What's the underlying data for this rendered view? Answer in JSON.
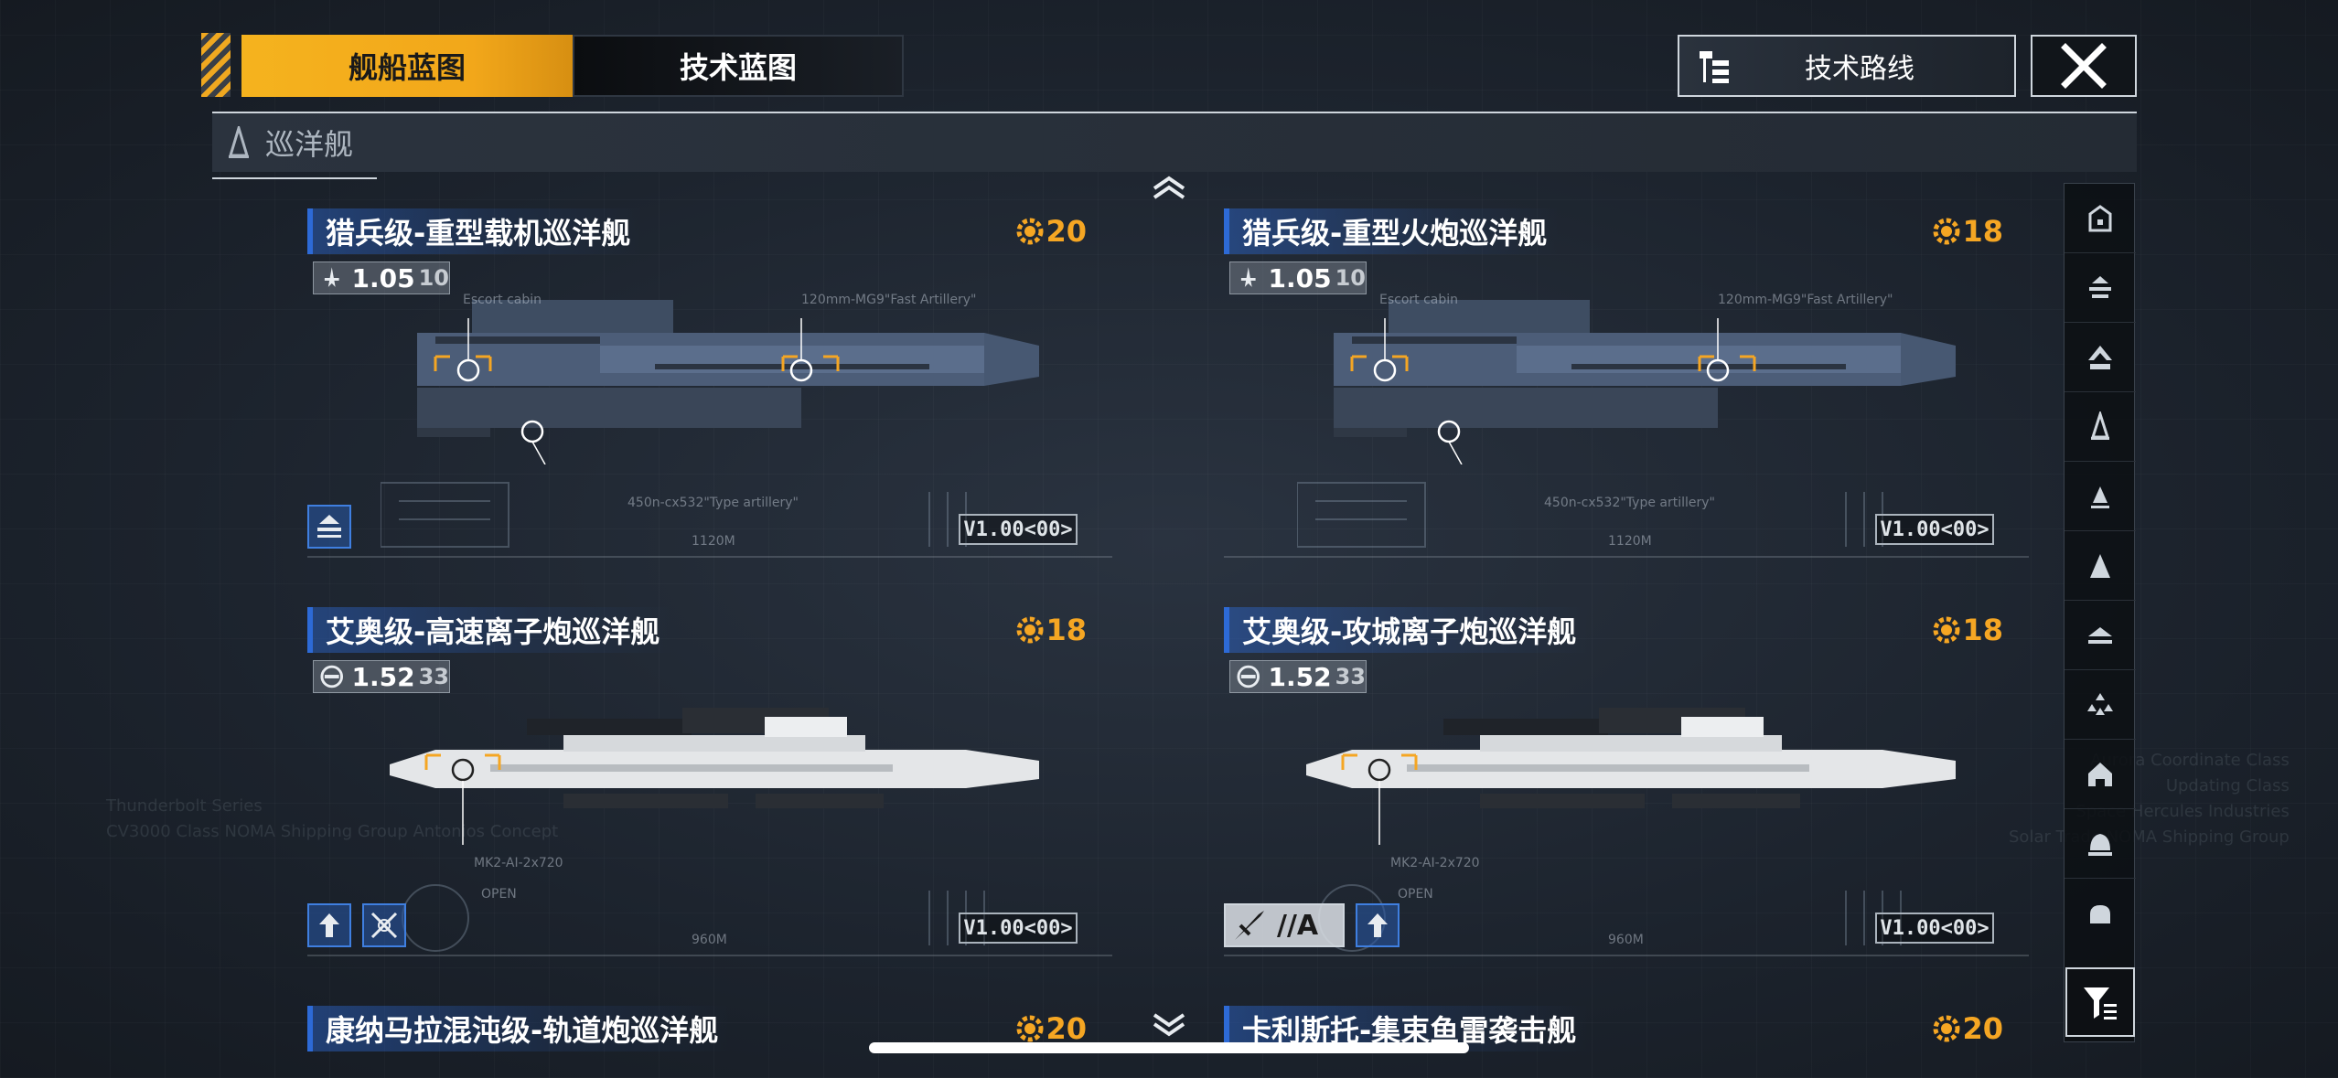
{
  "tabs": [
    {
      "label": "舰船蓝图",
      "active": true
    },
    {
      "label": "技术蓝图",
      "active": false
    }
  ],
  "route_button": {
    "label": "技术路线"
  },
  "category": {
    "label": "巡洋舰"
  },
  "cards": [
    {
      "title": "猎兵级-重型载机巡洋舰",
      "cost": "20",
      "version_main": "1.05",
      "version_sub": "10",
      "badge": "V1.00<00>",
      "ship": "dark",
      "annotations": [
        "Escort cabin",
        "120mm-MG9\"Fast Artillery\"",
        "450n-cx532\"Type artillery\"",
        "1120M"
      ],
      "tag_icons": [
        "carrier-tag-icon"
      ]
    },
    {
      "title": "猎兵级-重型火炮巡洋舰",
      "cost": "18",
      "version_main": "1.05",
      "version_sub": "10",
      "badge": "V1.00<00>",
      "ship": "dark",
      "annotations": [
        "Escort cabin",
        "120mm-MG9\"Fast Artillery\"",
        "450n-cx532\"Type artillery\"",
        "1120M"
      ],
      "tag_icons": []
    },
    {
      "title": "艾奥级-高速离子炮巡洋舰",
      "cost": "18",
      "version_main": "1.52",
      "version_sub": "33",
      "badge": "V1.00<00>",
      "ship": "white",
      "annotations": [
        "MK2-AI-2x720",
        "OPEN",
        "960M"
      ],
      "tag_icons": [
        "speed-tag-icon",
        "ion-tag-icon"
      ]
    },
    {
      "title": "艾奥级-攻城离子炮巡洋舰",
      "cost": "18",
      "version_main": "1.52",
      "version_sub": "33",
      "badge": "V1.00<00>",
      "ship": "white",
      "annotations": [
        "MK2-AI-2x720",
        "OPEN",
        "960M"
      ],
      "grade": "//A",
      "tag_icons": [
        "speed-tag-icon"
      ]
    },
    {
      "title": "康纳马拉混沌级-轨道炮巡洋舰",
      "cost": "20"
    },
    {
      "title": "卡利斯托-集束鱼雷袭击舰",
      "cost": "20"
    }
  ],
  "background_text": {
    "left": "Thunderbolt Series\nCV3000 Class NOMA Shipping Group Antonios Concept",
    "right": "Aurora Coordinate Class\nUpdating Class\nSpace Hercules Industries\nSolar Trade NOMA Shipping Group"
  },
  "colors": {
    "accent": "#f5b31e",
    "cost": "#f5a623",
    "tag_blue": "#3f7fe0",
    "title_blue": "#2d6ad6"
  }
}
